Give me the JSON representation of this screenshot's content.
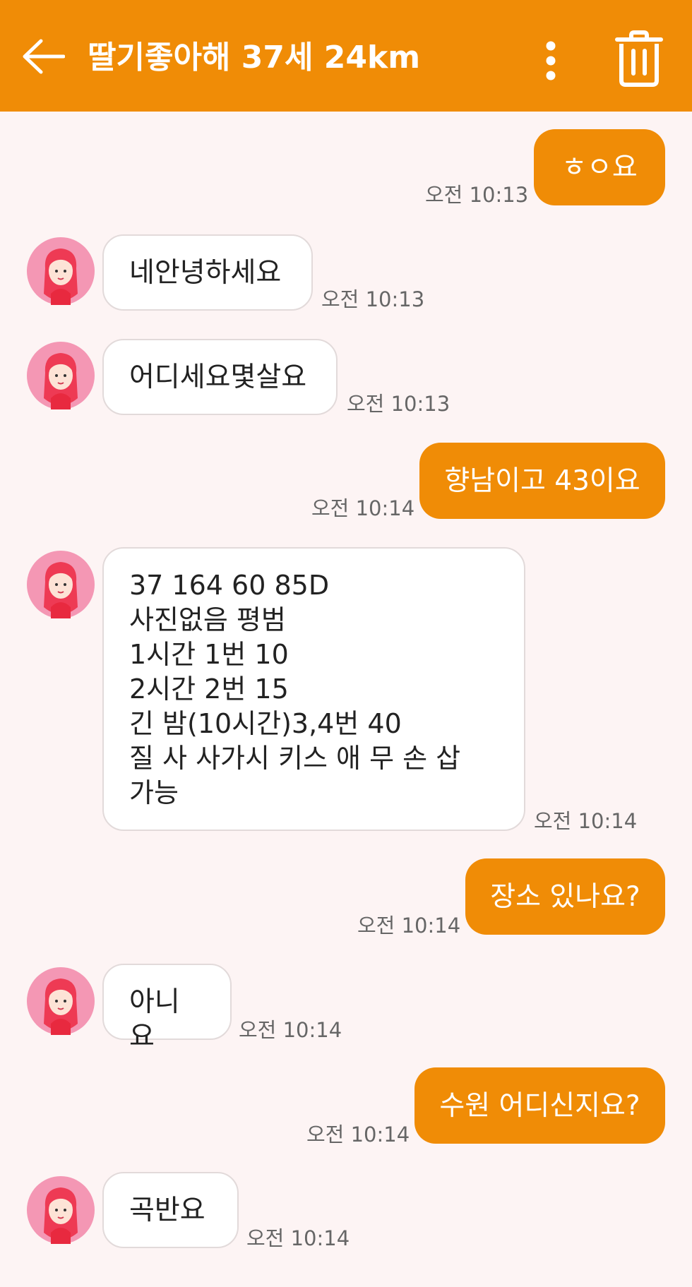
{
  "header": {
    "title": "딸기좋아해 37세 24km",
    "back_icon": "arrow-left-icon",
    "more_icon": "more-vertical-icon",
    "delete_icon": "trash-icon"
  },
  "colors": {
    "accent": "#f08c06",
    "background": "#fdf4f4",
    "received_bubble": "#ffffff"
  },
  "messages": [
    {
      "direction": "sent",
      "text": "ㅎㅇ요",
      "time": "오전 10:13"
    },
    {
      "direction": "received",
      "text": "네안녕하세요",
      "time": "오전 10:13"
    },
    {
      "direction": "received",
      "text": "어디세요몇살요",
      "time": "오전 10:13"
    },
    {
      "direction": "sent",
      "text": "향남이고 43이요",
      "time": "오전 10:14"
    },
    {
      "direction": "received",
      "text": "37 164 60 85D\n사진없음 평범\n1시간 1번 10\n2시간 2번 15\n긴 밤(10시간)3,4번 40\n질 사 사가시 키스 애 무 손 삽\n가능",
      "time": "오전 10:14"
    },
    {
      "direction": "sent",
      "text": "장소 있나요?",
      "time": "오전 10:14"
    },
    {
      "direction": "received",
      "text": "아니요",
      "time": "오전 10:14"
    },
    {
      "direction": "sent",
      "text": "수원 어디신지요?",
      "time": "오전 10:14"
    },
    {
      "direction": "received",
      "text": "곡반요",
      "time": "오전 10:14"
    }
  ]
}
